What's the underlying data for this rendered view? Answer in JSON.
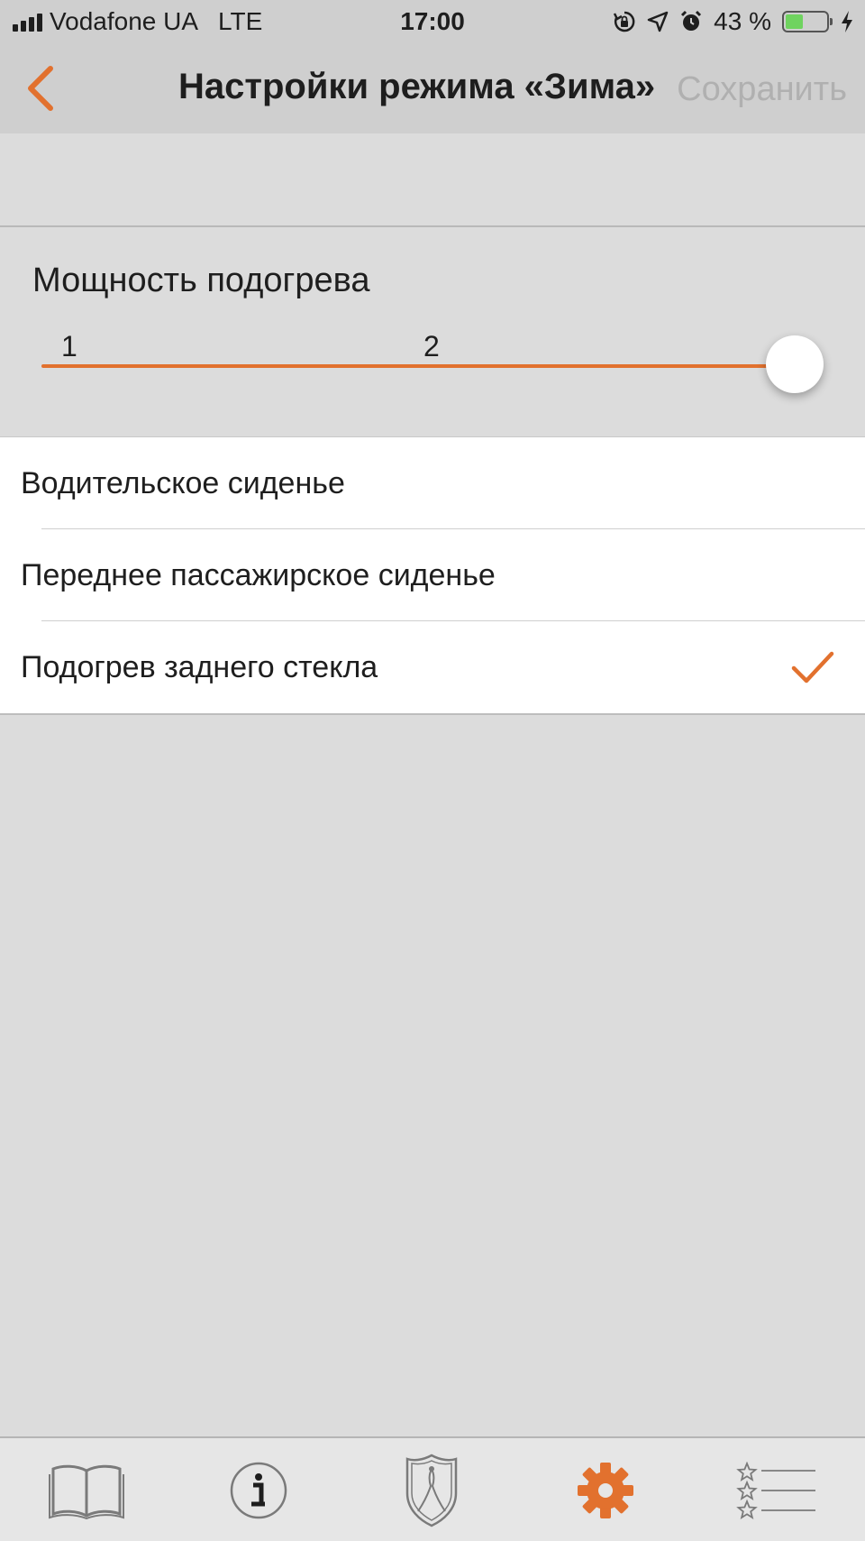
{
  "status_bar": {
    "carrier": "Vodafone UA",
    "network": "LTE",
    "time": "17:00",
    "battery_percent": "43 %",
    "battery_level": 0.43,
    "battery_color": "#6fd35f",
    "icons": [
      "signal-icon",
      "rotation-lock-icon",
      "location-icon",
      "alarm-icon",
      "battery-icon",
      "charging-icon"
    ]
  },
  "nav": {
    "back_icon": "chevron-left-icon",
    "title": "Настройки режима «Зима»",
    "save_label": "Сохранить"
  },
  "heating_power": {
    "label": "Мощность подогрева",
    "ticks": [
      "1",
      "2"
    ],
    "value": 3,
    "accent_color": "#e2712e"
  },
  "options": [
    {
      "label": "Водительское сиденье",
      "checked": false
    },
    {
      "label": "Переднее пассажирское сиденье",
      "checked": false
    },
    {
      "label": "Подогрев заднего стекла",
      "checked": true
    }
  ],
  "tabbar": {
    "active_tab": "settings",
    "active_color": "#e2712e",
    "tabs": [
      {
        "id": "manual",
        "icon": "book-icon"
      },
      {
        "id": "info",
        "icon": "info-icon"
      },
      {
        "id": "home",
        "icon": "brand-emblem-icon"
      },
      {
        "id": "settings",
        "icon": "gear-icon"
      },
      {
        "id": "favorites",
        "icon": "star-list-icon"
      }
    ]
  }
}
